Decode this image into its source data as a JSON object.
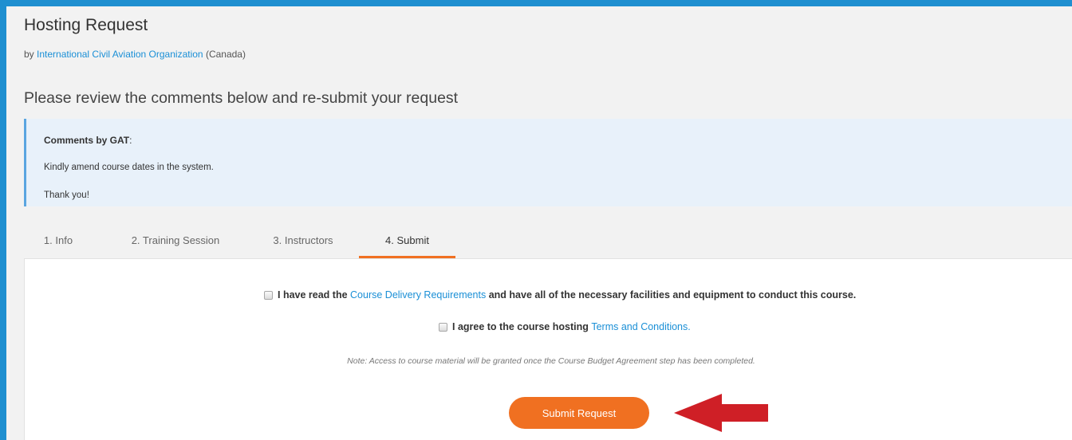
{
  "header": {
    "title": "Hosting Request",
    "by_prefix": "by",
    "organization": "International Civil Aviation Organization",
    "country": "(Canada)"
  },
  "review_heading": "Please review the comments below and re-submit your request",
  "comments": {
    "title_bold": "Comments by GAT",
    "title_suffix": ":",
    "lines": [
      "Kindly amend course dates in the system.",
      "Thank you!"
    ]
  },
  "tabs": [
    {
      "label": "1. Info",
      "active": false
    },
    {
      "label": "2. Training Session",
      "active": false
    },
    {
      "label": "3. Instructors",
      "active": false
    },
    {
      "label": "4. Submit",
      "active": true
    }
  ],
  "submit_step": {
    "check1": {
      "prefix": "I have read the",
      "link": "Course Delivery Requirements",
      "suffix": "and have all of the necessary facilities and equipment to conduct this course.",
      "checked": false
    },
    "check2": {
      "prefix": "I agree to the course hosting",
      "link": "Terms and Conditions.",
      "checked": false
    },
    "note": "Note: Access to course material will be granted once the Course Budget Agreement step has been completed.",
    "submit_label": "Submit Request"
  },
  "colors": {
    "accent": "#f07021",
    "link": "#1a8fd6",
    "frame_border": "#1f8fd0",
    "arrow": "#cf1f26"
  },
  "annotation": "red-arrow-pointing-left"
}
